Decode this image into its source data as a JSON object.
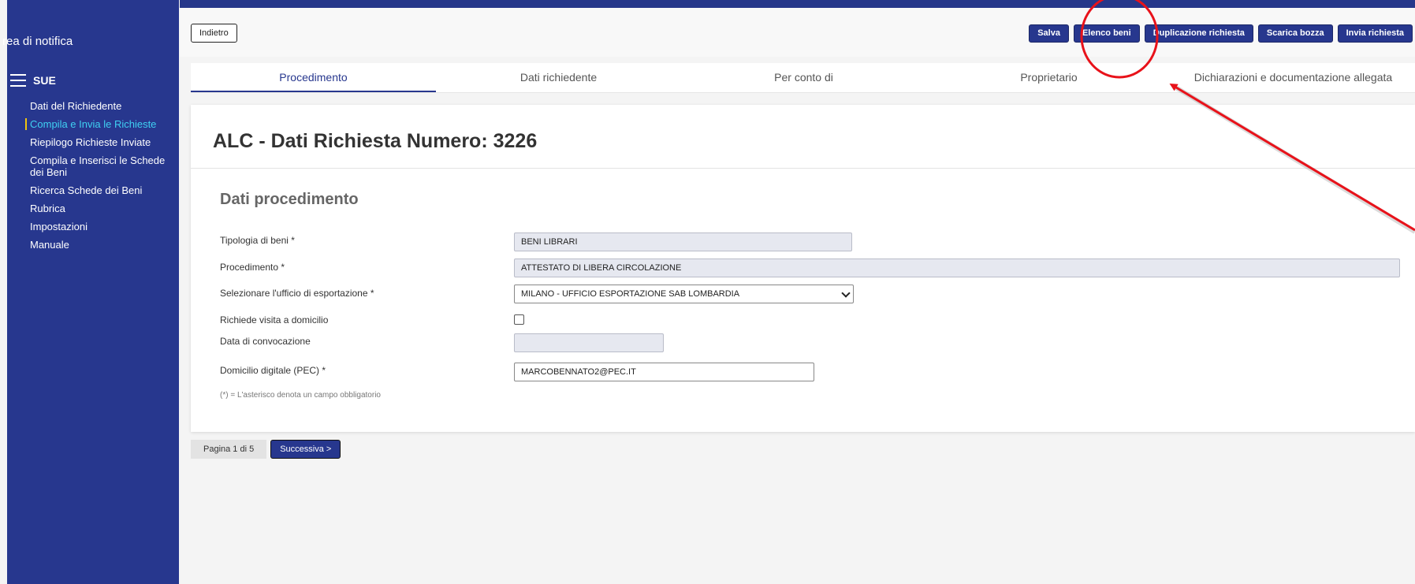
{
  "sidebar": {
    "title": "rea di notifica",
    "section": "SUE",
    "items": [
      {
        "label": "Dati del Richiedente"
      },
      {
        "label": "Compila e Invia le Richieste"
      },
      {
        "label": "Riepilogo Richieste Inviate"
      },
      {
        "label": "Compila e Inserisci le Schede dei Beni"
      },
      {
        "label": "Ricerca Schede dei Beni"
      },
      {
        "label": "Rubrica"
      },
      {
        "label": "Impostazioni"
      },
      {
        "label": "Manuale"
      }
    ]
  },
  "toolbar": {
    "back_label": "Indietro",
    "save_label": "Salva",
    "elenco_label": "Elenco beni",
    "duplicate_label": "Duplicazione richiesta",
    "download_label": "Scarica bozza",
    "send_label": "Invia richiesta"
  },
  "tabs": [
    {
      "label": "Procedimento"
    },
    {
      "label": "Dati richiedente"
    },
    {
      "label": "Per conto di"
    },
    {
      "label": "Proprietario"
    },
    {
      "label": "Dichiarazioni e documentazione allegata"
    }
  ],
  "panel": {
    "title": "ALC - Dati Richiesta Numero: 3226",
    "section_title": "Dati procedimento",
    "fields": {
      "tipologia_label": "Tipologia di beni *",
      "tipologia_value": "BENI LIBRARI",
      "procedimento_label": "Procedimento *",
      "procedimento_value": "ATTESTATO DI LIBERA CIRCOLAZIONE",
      "ufficio_label": "Selezionare l'ufficio di esportazione *",
      "ufficio_value": "MILANO - UFFICIO ESPORTAZIONE SAB LOMBARDIA",
      "visita_label": "Richiede visita a domicilio",
      "data_label": "Data di convocazione",
      "data_value": "",
      "pec_label": "Domicilio digitale (PEC) *",
      "pec_value": "MARCOBENNATO2@PEC.IT"
    },
    "footnote": "(*) = L'asterisco denota un campo obbligatorio"
  },
  "pager": {
    "text": "Pagina 1 di 5",
    "next_label": "Successiva >"
  },
  "colors": {
    "primary": "#27378e",
    "active_link": "#3fd0f2",
    "annotation": "#e8121a"
  }
}
